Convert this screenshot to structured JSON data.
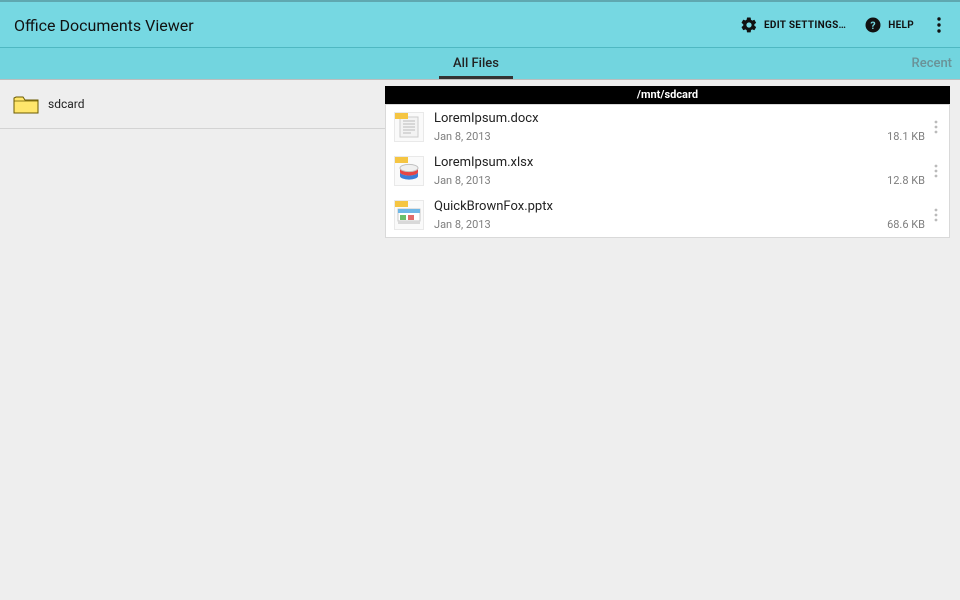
{
  "app": {
    "title": "Office Documents Viewer",
    "actions": {
      "edit_settings": "EDIT SETTINGS…",
      "help": "HELP"
    }
  },
  "tabs": {
    "active": "All Files",
    "peek_right": "Recent"
  },
  "sidebar": {
    "folders": [
      {
        "name": "sdcard"
      }
    ]
  },
  "content": {
    "path": "/mnt/sdcard",
    "files": [
      {
        "name": "LoremIpsum.docx",
        "date": "Jan 8, 2013",
        "size": "18.1 KB",
        "type": "docx"
      },
      {
        "name": "LoremIpsum.xlsx",
        "date": "Jan 8, 2013",
        "size": "12.8 KB",
        "type": "xlsx"
      },
      {
        "name": "QuickBrownFox.pptx",
        "date": "Jan 8, 2013",
        "size": "68.6 KB",
        "type": "pptx"
      }
    ]
  }
}
